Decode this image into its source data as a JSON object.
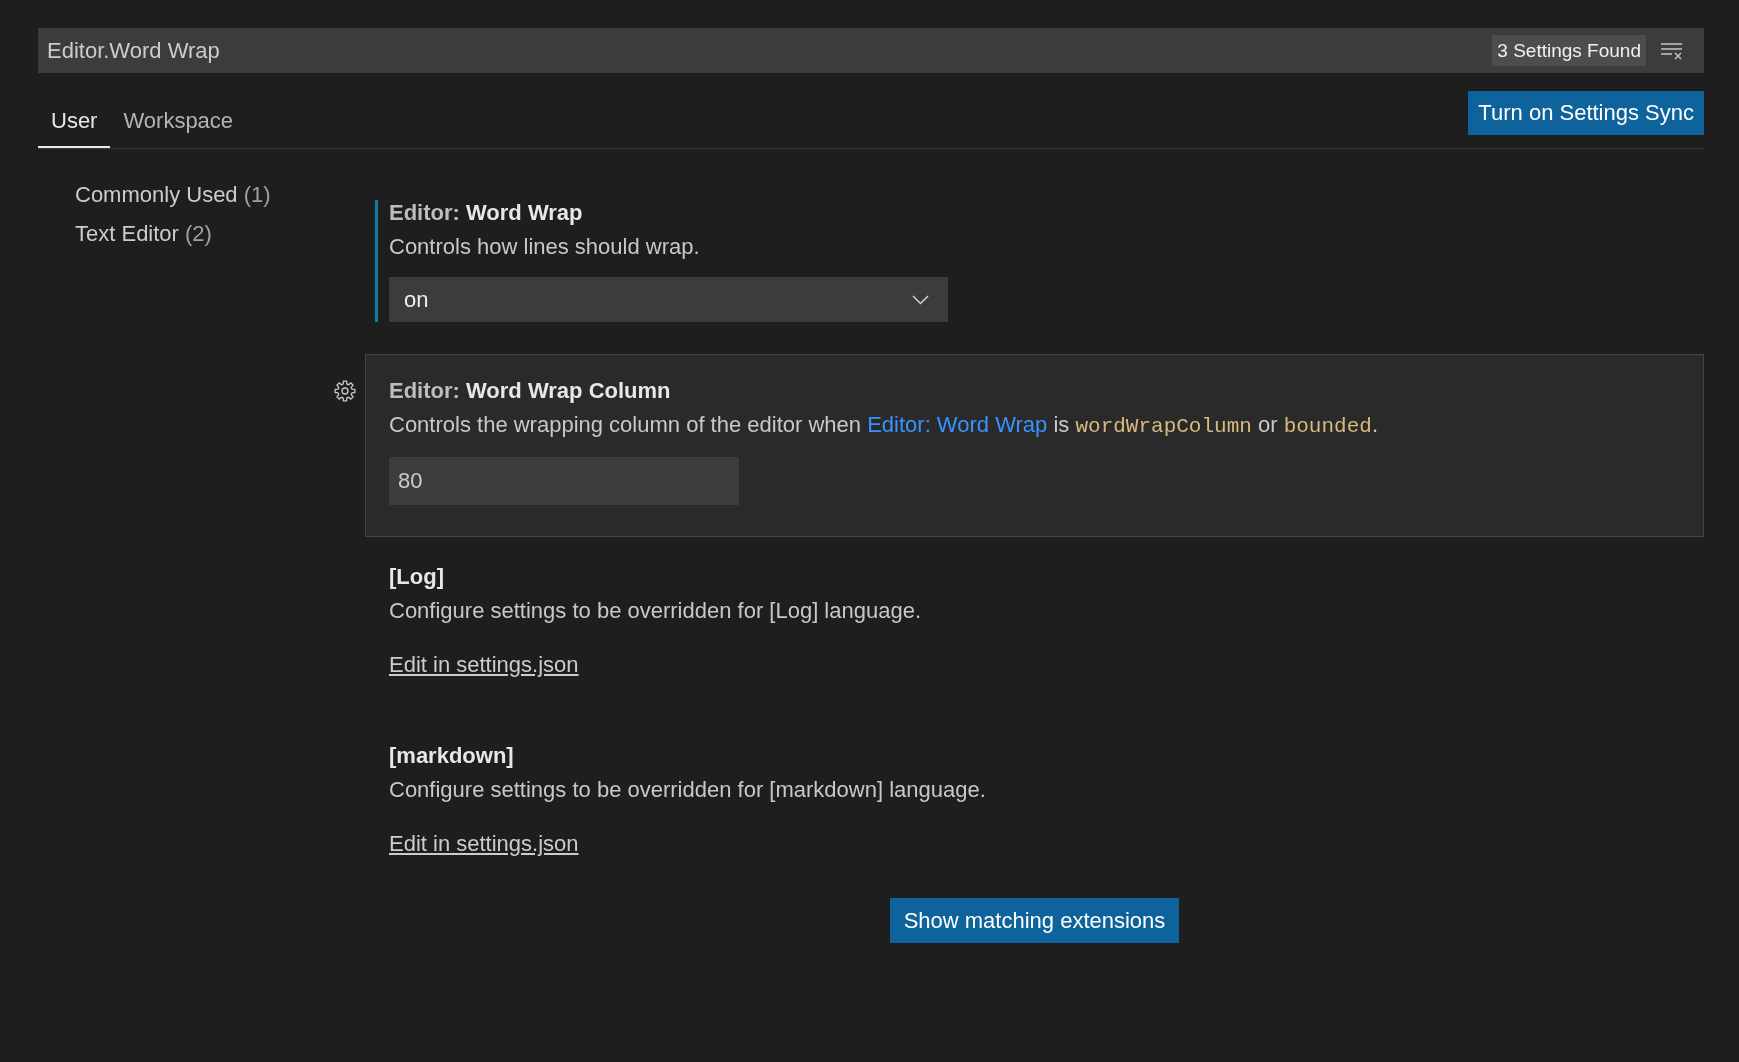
{
  "search": {
    "value": "Editor.Word Wrap",
    "results": "3 Settings Found"
  },
  "tabs": [
    {
      "label": "User",
      "selected": true
    },
    {
      "label": "Workspace",
      "selected": false
    }
  ],
  "sync_button": "Turn on Settings Sync",
  "sidebar": {
    "items": [
      {
        "label": "Commonly Used",
        "count": "(1)"
      },
      {
        "label": "Text Editor",
        "count": "(2)"
      }
    ]
  },
  "settings": [
    {
      "kind": "dropdown",
      "category": "Editor:",
      "name": "Word Wrap",
      "description": [
        {
          "kind": "text",
          "text": "Controls how lines should wrap."
        }
      ],
      "value": "on",
      "focused": true,
      "highlighted": false
    },
    {
      "kind": "number",
      "category": "Editor:",
      "name": "Word Wrap Column",
      "description": [
        {
          "kind": "text",
          "text": "Controls the wrapping column of the editor when "
        },
        {
          "kind": "link",
          "text": "Editor: Word Wrap"
        },
        {
          "kind": "text",
          "text": " is "
        },
        {
          "kind": "code",
          "text": "wordWrapColumn"
        },
        {
          "kind": "text",
          "text": " or "
        },
        {
          "kind": "code",
          "text": "bounded"
        },
        {
          "kind": "text",
          "text": "."
        }
      ],
      "value": "80",
      "focused": false,
      "highlighted": true
    }
  ],
  "language_overrides": [
    {
      "title": "[Log]",
      "description": "Configure settings to be overridden for [Log] language.",
      "link": "Edit in settings.json"
    },
    {
      "title": "[markdown]",
      "description": "Configure settings to be overridden for [markdown] language.",
      "link": "Edit in settings.json"
    }
  ],
  "extensions_button": "Show matching extensions"
}
